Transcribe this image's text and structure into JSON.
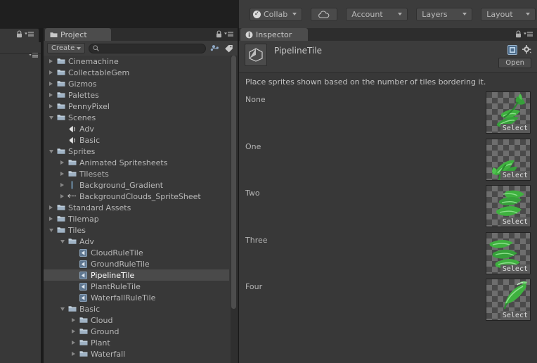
{
  "toolbar": {
    "collab_label": "Collab",
    "collab_icon": "checkmark-icon",
    "cloud_icon": "cloud-icon",
    "account_label": "Account",
    "layers_label": "Layers",
    "layout_label": "Layout"
  },
  "project": {
    "tab_label": "Project",
    "tab_icon": "folder-icon",
    "create_label": "Create",
    "search_placeholder": "",
    "search_value": "",
    "search_icon": "search-icon",
    "lock_icon": "lock-icon",
    "menu_icon": "hamburger-menu-icon",
    "favorite_icon": "people-icon",
    "label_icon": "tag-icon",
    "tree": [
      {
        "label": "Cinemachine",
        "depth": 0,
        "icon": "folder-icon",
        "arrow": "right",
        "selected": false
      },
      {
        "label": "CollectableGem",
        "depth": 0,
        "icon": "folder-icon",
        "arrow": "right",
        "selected": false
      },
      {
        "label": "Gizmos",
        "depth": 0,
        "icon": "folder-icon",
        "arrow": "right",
        "selected": false
      },
      {
        "label": "Palettes",
        "depth": 0,
        "icon": "folder-icon",
        "arrow": "right",
        "selected": false
      },
      {
        "label": "PennyPixel",
        "depth": 0,
        "icon": "folder-icon",
        "arrow": "right",
        "selected": false
      },
      {
        "label": "Scenes",
        "depth": 0,
        "icon": "folder-icon",
        "arrow": "down",
        "selected": false
      },
      {
        "label": "Adv",
        "depth": 1,
        "icon": "scene-icon",
        "arrow": "none",
        "selected": false
      },
      {
        "label": "Basic",
        "depth": 1,
        "icon": "scene-icon",
        "arrow": "none",
        "selected": false
      },
      {
        "label": "Sprites",
        "depth": 0,
        "icon": "folder-icon",
        "arrow": "down",
        "selected": false
      },
      {
        "label": "Animated Spritesheets",
        "depth": 1,
        "icon": "folder-icon",
        "arrow": "right",
        "selected": false
      },
      {
        "label": "Tilesets",
        "depth": 1,
        "icon": "folder-icon",
        "arrow": "right",
        "selected": false
      },
      {
        "label": "Background_Gradient",
        "depth": 1,
        "icon": "sprite-icon",
        "arrow": "right",
        "selected": false
      },
      {
        "label": "BackgroundClouds_SpriteSheet",
        "depth": 1,
        "icon": "spritesheet-icon",
        "arrow": "right",
        "selected": false
      },
      {
        "label": "Standard Assets",
        "depth": 0,
        "icon": "folder-icon",
        "arrow": "right",
        "selected": false
      },
      {
        "label": "Tilemap",
        "depth": 0,
        "icon": "folder-icon",
        "arrow": "right",
        "selected": false
      },
      {
        "label": "Tiles",
        "depth": 0,
        "icon": "folder-icon",
        "arrow": "down",
        "selected": false
      },
      {
        "label": "Adv",
        "depth": 1,
        "icon": "folder-icon",
        "arrow": "down",
        "selected": false
      },
      {
        "label": "CloudRuleTile",
        "depth": 2,
        "icon": "tile-icon",
        "arrow": "none",
        "selected": false
      },
      {
        "label": "GroundRuleTile",
        "depth": 2,
        "icon": "tile-icon",
        "arrow": "none",
        "selected": false
      },
      {
        "label": "PipelineTile",
        "depth": 2,
        "icon": "tile-icon",
        "arrow": "none",
        "selected": true
      },
      {
        "label": "PlantRuleTile",
        "depth": 2,
        "icon": "tile-icon",
        "arrow": "none",
        "selected": false
      },
      {
        "label": "WaterfallRuleTile",
        "depth": 2,
        "icon": "tile-icon",
        "arrow": "none",
        "selected": false
      },
      {
        "label": "Basic",
        "depth": 1,
        "icon": "folder-icon",
        "arrow": "down",
        "selected": false
      },
      {
        "label": "Cloud",
        "depth": 2,
        "icon": "folder-icon",
        "arrow": "right",
        "selected": false
      },
      {
        "label": "Ground",
        "depth": 2,
        "icon": "folder-icon",
        "arrow": "right",
        "selected": false
      },
      {
        "label": "Plant",
        "depth": 2,
        "icon": "folder-icon",
        "arrow": "right",
        "selected": false
      },
      {
        "label": "Waterfall",
        "depth": 2,
        "icon": "folder-icon",
        "arrow": "right",
        "selected": false
      }
    ]
  },
  "inspector": {
    "tab_label": "Inspector",
    "tab_icon": "info-icon",
    "lock_icon": "lock-icon",
    "menu_icon": "hamburger-menu-icon",
    "preset_icon": "preset-icon",
    "gear_icon": "gear-icon",
    "asset_name": "PipelineTile",
    "asset_icon": "scriptable-object-icon",
    "open_label": "Open",
    "description": "Place sprites shown based on the number of tiles bordering it.",
    "sprite_rows": [
      {
        "label": "None",
        "select_label": "Select",
        "sprite": "plant-sprite-none"
      },
      {
        "label": "One",
        "select_label": "Select",
        "sprite": "plant-sprite-one"
      },
      {
        "label": "Two",
        "select_label": "Select",
        "sprite": "plant-sprite-two"
      },
      {
        "label": "Three",
        "select_label": "Select",
        "sprite": "plant-sprite-three"
      },
      {
        "label": "Four",
        "select_label": "Select",
        "sprite": "plant-sprite-four"
      }
    ]
  },
  "colors": {
    "panel_bg": "#383838",
    "toolbar_bg": "#3c3c3c",
    "window_bg": "#1f1f1f",
    "tab_bg": "#4c4c4c",
    "selection": "#4a4a4a",
    "text": "#b4b4b4",
    "sprite_green": "#3ea83e"
  }
}
